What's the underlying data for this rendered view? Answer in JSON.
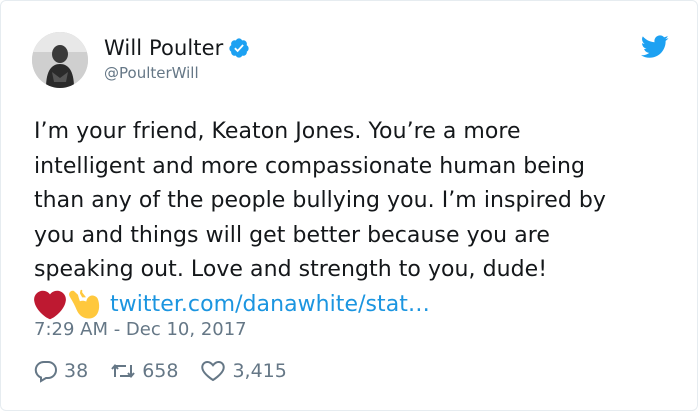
{
  "user": {
    "display_name": "Will Poulter",
    "handle": "@PoulterWill",
    "verified": true
  },
  "tweet": {
    "lines": [
      "I’m your friend, Keaton Jones. You’re a more",
      "intelligent and more compassionate human being",
      "than any of the people bullying you. I’m inspired by",
      "you and things will get better because you are",
      "speaking out. Love and strength to you, dude!"
    ],
    "emojis": [
      "heart-emoji",
      "flexed-biceps-emoji"
    ],
    "link_text": "twitter.com/danawhite/stat…",
    "timestamp": "7:29 AM - Dec 10, 2017"
  },
  "actions": {
    "replies": "38",
    "retweets": "658",
    "likes": "3,415"
  },
  "colors": {
    "link": "#1b95e0",
    "muted": "#657786",
    "text": "#14171a",
    "verified": "#1da1f2",
    "heart": "#be1931",
    "biceps": "#ffc83d"
  }
}
